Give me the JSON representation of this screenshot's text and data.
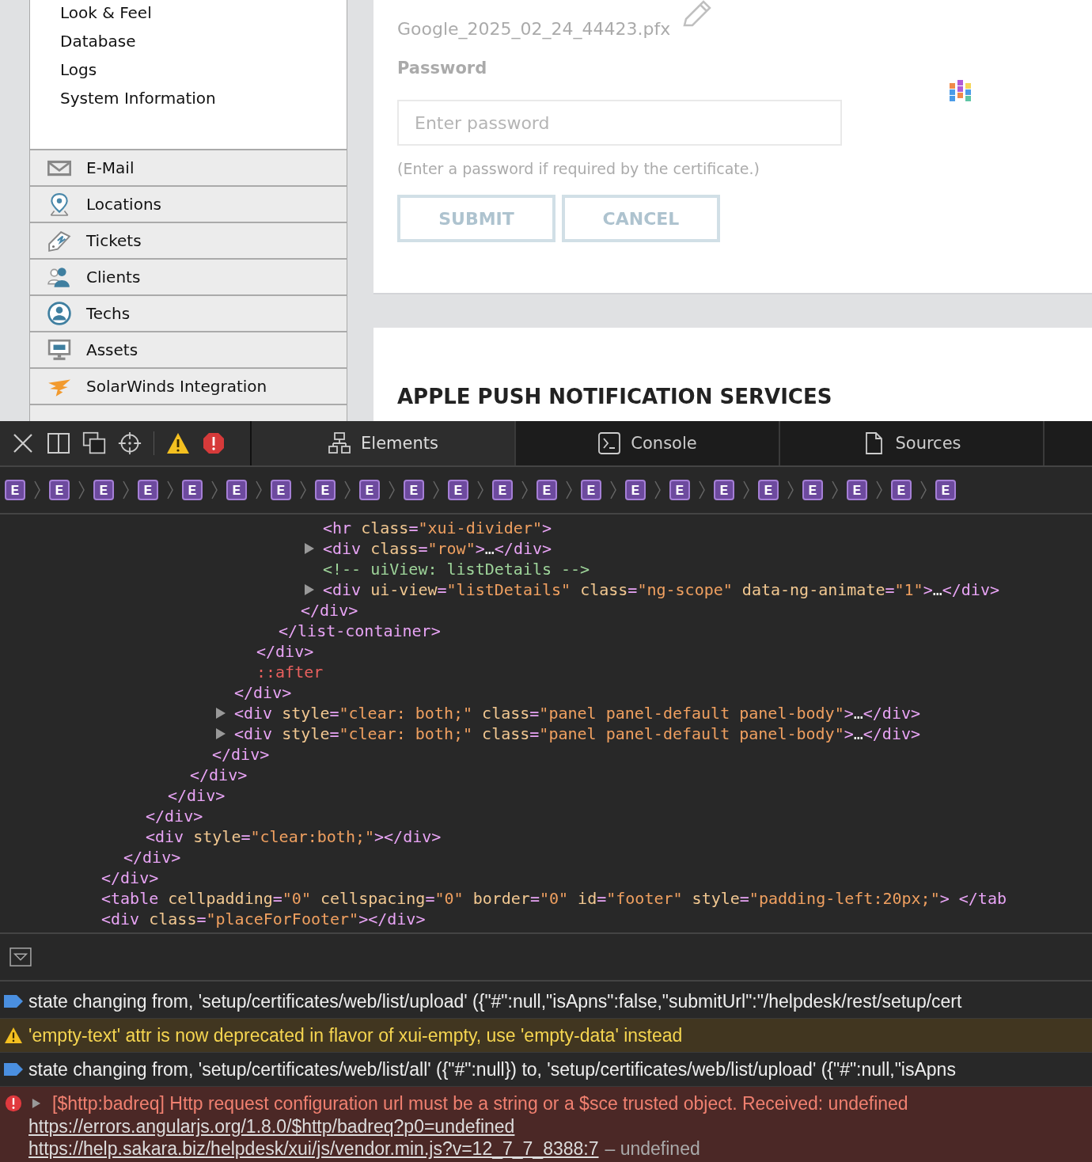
{
  "sidebar": {
    "settings_items": [
      "Look & Feel",
      "Database",
      "Logs",
      "System Information"
    ],
    "nav_items": [
      {
        "kind": "mail",
        "label": "E-Mail"
      },
      {
        "kind": "pin",
        "label": "Locations"
      },
      {
        "kind": "ticket",
        "label": "Tickets"
      },
      {
        "kind": "people",
        "label": "Clients"
      },
      {
        "kind": "person",
        "label": "Techs"
      },
      {
        "kind": "monitor",
        "label": "Assets"
      },
      {
        "kind": "bird",
        "label": "SolarWinds Integration"
      }
    ]
  },
  "certificate_form": {
    "loading": true,
    "file_name": "Google_2025_02_24_44423.pfx",
    "password_label": "Password",
    "password_placeholder": "Enter password",
    "hint": "(Enter a password if required by the certificate.)",
    "buttons": [
      "SUBMIT",
      "CANCEL"
    ]
  },
  "apns_section": {
    "title": "APPLE PUSH NOTIFICATION SERVICES"
  },
  "devtools": {
    "tabs": [
      {
        "kind": "elements",
        "label": "Elements",
        "selected": true
      },
      {
        "kind": "console",
        "label": "Console",
        "selected": false
      },
      {
        "kind": "sources",
        "label": "Sources",
        "selected": false
      }
    ],
    "breadcrumb": [
      "E",
      "E",
      "E",
      "E",
      "E",
      "E",
      "E",
      "E",
      "E",
      "E",
      "E",
      "E",
      "E",
      "E",
      "E",
      "E",
      "E",
      "E",
      "E",
      "E",
      "E",
      "E"
    ],
    "dom_tree": [
      {
        "children": [
          {
            "children": [
              {
                "children": [
                  {
                    "children": [
                      {
                        "children": [
                          {
                            "children": [
                              {
                                "children": [
                                  {
                                    "children": [
                                      {
                                        "children": [
                                          {
                                            "children": [
                                              {
                                                "tokens": [
                                                  {
                                                    "kind": "tag",
                                                    "text": "<hr "
                                                  },
                                                  {
                                                    "kind": "attr",
                                                    "text": "class"
                                                  },
                                                  {
                                                    "kind": "tag",
                                                    "text": "="
                                                  },
                                                  {
                                                    "kind": "value",
                                                    "text": "\"xui-divider\""
                                                  },
                                                  {
                                                    "kind": "tag",
                                                    "text": ">"
                                                  }
                                                ],
                                                "expandable": false
                                              },
                                              {
                                                "tokens": [
                                                  {
                                                    "kind": "tag",
                                                    "text": "<div "
                                                  },
                                                  {
                                                    "kind": "attr",
                                                    "text": "class"
                                                  },
                                                  {
                                                    "kind": "tag",
                                                    "text": "="
                                                  },
                                                  {
                                                    "kind": "value",
                                                    "text": "\"row\""
                                                  },
                                                  {
                                                    "kind": "tag",
                                                    "text": ">"
                                                  },
                                                  {
                                                    "kind": "text",
                                                    "text": "…"
                                                  },
                                                  {
                                                    "kind": "tag",
                                                    "text": "</div>"
                                                  }
                                                ],
                                                "expandable": true
                                              },
                                              {
                                                "tokens": [
                                                  {
                                                    "kind": "comment",
                                                    "text": "<!-- uiView: listDetails -->"
                                                  }
                                                ],
                                                "expandable": false
                                              },
                                              {
                                                "tokens": [
                                                  {
                                                    "kind": "tag",
                                                    "text": "<div "
                                                  },
                                                  {
                                                    "kind": "attr",
                                                    "text": "ui-view"
                                                  },
                                                  {
                                                    "kind": "tag",
                                                    "text": "="
                                                  },
                                                  {
                                                    "kind": "value",
                                                    "text": "\"listDetails\""
                                                  },
                                                  {
                                                    "kind": "attr",
                                                    "text": " class"
                                                  },
                                                  {
                                                    "kind": "tag",
                                                    "text": "="
                                                  },
                                                  {
                                                    "kind": "value",
                                                    "text": "\"ng-scope\""
                                                  },
                                                  {
                                                    "kind": "attr",
                                                    "text": " data-ng-animate"
                                                  },
                                                  {
                                                    "kind": "tag",
                                                    "text": "="
                                                  },
                                                  {
                                                    "kind": "value",
                                                    "text": "\"1\""
                                                  },
                                                  {
                                                    "kind": "tag",
                                                    "text": ">"
                                                  },
                                                  {
                                                    "kind": "text",
                                                    "text": "…"
                                                  },
                                                  {
                                                    "kind": "tag",
                                                    "text": "</div>"
                                                  }
                                                ],
                                                "expandable": true
                                              }
                                            ]
                                          },
                                          {
                                            "tokens": [
                                              {
                                                "kind": "tag",
                                                "text": "</div>"
                                              }
                                            ],
                                            "expandable": false
                                          }
                                        ]
                                      },
                                      {
                                        "tokens": [
                                          {
                                            "kind": "tag",
                                            "text": "</list-container>"
                                          }
                                        ],
                                        "expandable": false
                                      }
                                    ]
                                  },
                                  {
                                    "tokens": [
                                      {
                                        "kind": "tag",
                                        "text": "</div>"
                                      }
                                    ],
                                    "expandable": false
                                  },
                                  {
                                    "tokens": [
                                      {
                                        "kind": "pseudo",
                                        "text": "::after"
                                      }
                                    ],
                                    "expandable": false
                                  }
                                ]
                              },
                              {
                                "tokens": [
                                  {
                                    "kind": "tag",
                                    "text": "</div>"
                                  }
                                ],
                                "expandable": false
                              },
                              {
                                "tokens": [
                                  {
                                    "kind": "tag",
                                    "text": "<div "
                                  },
                                  {
                                    "kind": "attr",
                                    "text": "style"
                                  },
                                  {
                                    "kind": "tag",
                                    "text": "="
                                  },
                                  {
                                    "kind": "value",
                                    "text": "\"clear: both;\""
                                  },
                                  {
                                    "kind": "attr",
                                    "text": " class"
                                  },
                                  {
                                    "kind": "tag",
                                    "text": "="
                                  },
                                  {
                                    "kind": "value",
                                    "text": "\"panel panel-default panel-body\""
                                  },
                                  {
                                    "kind": "tag",
                                    "text": ">"
                                  },
                                  {
                                    "kind": "text",
                                    "text": "…"
                                  },
                                  {
                                    "kind": "tag",
                                    "text": "</div>"
                                  }
                                ],
                                "expandable": true
                              },
                              {
                                "tokens": [
                                  {
                                    "kind": "tag",
                                    "text": "<div "
                                  },
                                  {
                                    "kind": "attr",
                                    "text": "style"
                                  },
                                  {
                                    "kind": "tag",
                                    "text": "="
                                  },
                                  {
                                    "kind": "value",
                                    "text": "\"clear: both;\""
                                  },
                                  {
                                    "kind": "attr",
                                    "text": " class"
                                  },
                                  {
                                    "kind": "tag",
                                    "text": "="
                                  },
                                  {
                                    "kind": "value",
                                    "text": "\"panel panel-default panel-body\""
                                  },
                                  {
                                    "kind": "tag",
                                    "text": ">"
                                  },
                                  {
                                    "kind": "text",
                                    "text": "…"
                                  },
                                  {
                                    "kind": "tag",
                                    "text": "</div>"
                                  }
                                ],
                                "expandable": true
                              }
                            ]
                          },
                          {
                            "tokens": [
                              {
                                "kind": "tag",
                                "text": "</div>"
                              }
                            ],
                            "expandable": false
                          }
                        ]
                      },
                      {
                        "tokens": [
                          {
                            "kind": "tag",
                            "text": "</div>"
                          }
                        ],
                        "expandable": false
                      }
                    ]
                  },
                  {
                    "tokens": [
                      {
                        "kind": "tag",
                        "text": "</div>"
                      }
                    ],
                    "expandable": false
                  }
                ]
              },
              {
                "tokens": [
                  {
                    "kind": "tag",
                    "text": "</div>"
                  }
                ],
                "expandable": false
              },
              {
                "tokens": [
                  {
                    "kind": "tag",
                    "text": "<div "
                  },
                  {
                    "kind": "attr",
                    "text": "style"
                  },
                  {
                    "kind": "tag",
                    "text": "="
                  },
                  {
                    "kind": "value",
                    "text": "\"clear:both;\""
                  },
                  {
                    "kind": "tag",
                    "text": "></div>"
                  }
                ],
                "expandable": false
              }
            ]
          },
          {
            "tokens": [
              {
                "kind": "tag",
                "text": "</div>"
              }
            ],
            "expandable": false
          }
        ]
      },
      {
        "tokens": [
          {
            "kind": "tag",
            "text": "</div>"
          }
        ],
        "expandable": false
      },
      {
        "tokens": [
          {
            "kind": "tag",
            "text": "<table "
          },
          {
            "kind": "attr",
            "text": "cellpadding"
          },
          {
            "kind": "tag",
            "text": "="
          },
          {
            "kind": "value",
            "text": "\"0\""
          },
          {
            "kind": "attr",
            "text": " cellspacing"
          },
          {
            "kind": "tag",
            "text": "="
          },
          {
            "kind": "value",
            "text": "\"0\""
          },
          {
            "kind": "attr",
            "text": " border"
          },
          {
            "kind": "tag",
            "text": "="
          },
          {
            "kind": "value",
            "text": "\"0\""
          },
          {
            "kind": "attr",
            "text": " id"
          },
          {
            "kind": "tag",
            "text": "="
          },
          {
            "kind": "value",
            "text": "\"footer\""
          },
          {
            "kind": "attr",
            "text": " style"
          },
          {
            "kind": "tag",
            "text": "="
          },
          {
            "kind": "value",
            "text": "\"padding-left:20px;\""
          },
          {
            "kind": "tag",
            "text": "> </tab"
          }
        ],
        "expandable": false
      },
      {
        "tokens": [
          {
            "kind": "tag",
            "text": "<div "
          },
          {
            "kind": "attr",
            "text": "class"
          },
          {
            "kind": "tag",
            "text": "="
          },
          {
            "kind": "value",
            "text": "\"placeForFooter\""
          },
          {
            "kind": "tag",
            "text": "></div>"
          }
        ],
        "expandable": false
      }
    ],
    "console_messages": [
      {
        "kind": "info",
        "text": "state changing from, 'setup/certificates/web/list/upload' ({\"#\":null,\"isApns\":false,\"submitUrl\":\"/helpdesk/rest/setup/cert"
      },
      {
        "kind": "warning",
        "text": "'empty-text' attr is now deprecated in flavor of xui-empty, use 'empty-data' instead"
      },
      {
        "kind": "info",
        "text": "state changing from, 'setup/certificates/web/list/all' ({\"#\":null}) to, 'setup/certificates/web/list/upload' ({\"#\":null,\"isApns"
      },
      {
        "kind": "error",
        "text": "[$http:badreq] Http request configuration url must be a string or a $sce trusted object.  Received: undefined",
        "links": [
          "https://errors.angularjs.org/1.8.0/$http/badreq?p0=undefined",
          "https://help.sakara.biz/helpdesk/xui/js/vendor.min.js?v=12_7_7_8388:7"
        ],
        "suffix": "– undefined"
      }
    ]
  }
}
